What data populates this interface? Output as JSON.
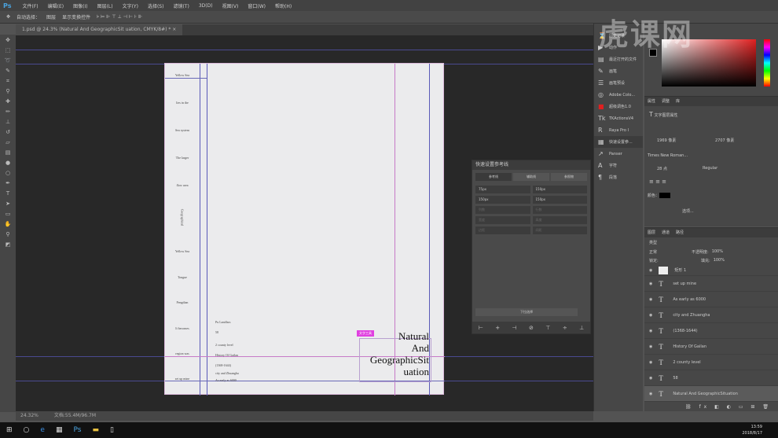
{
  "app": {
    "logo": "Ps",
    "menu": [
      "文件(F)",
      "编辑(E)",
      "图像(I)",
      "图层(L)",
      "文字(Y)",
      "选择(S)",
      "滤镜(T)",
      "3D(D)",
      "视图(V)",
      "窗口(W)",
      "帮助(H)"
    ]
  },
  "options": {
    "auto_select": "自动选择：",
    "layer_select": "图层",
    "show_transform": "显示变换控件"
  },
  "document": {
    "tab": "1.psd @ 24.3% (Natural And GeographicSit uation, CMYK/8#) * ×",
    "zoom": "24.32%",
    "doc_info": "文档:55.4M/96.7M"
  },
  "page": {
    "left_column": [
      "Yellow Sea",
      "lies in the",
      "Sea system",
      "The larger",
      "flow area",
      "Geographical",
      "Yellow Sea",
      "Tongue",
      "Pengdian",
      "It becomes",
      "region was",
      "set up mine"
    ],
    "body_lines": [
      "Pu Landfars",
      "58",
      "2 county level",
      "History Of Gailan",
      "(1368-1644)",
      "city and Zhuangha",
      "As early as 6000"
    ],
    "title": [
      "Natural",
      "And",
      "GeographicSit",
      "uation"
    ],
    "badge": "文字工具"
  },
  "quick_guide": {
    "title": "快速设置参考线",
    "tabs": [
      "参考线",
      "辅助线",
      "参照物"
    ],
    "fields": [
      "75px",
      "150px",
      "150px",
      "150px",
      "列数",
      "行数",
      "宽度",
      "高度",
      "边距",
      "间距"
    ],
    "footer": "下拉选择"
  },
  "dock": {
    "items": [
      "历史记录",
      "动作",
      "最近打开的文件",
      "画笔",
      "画笔预设",
      "Adobe Colo...",
      "超级调色1.0",
      "TKActionsV4",
      "Raya Pro I",
      "快速设置参...",
      "Panser",
      "字符",
      "段落"
    ]
  },
  "properties": {
    "tabs": [
      "属性",
      "调整",
      "库"
    ],
    "layer_type": "文字图层属性",
    "width": "1969 像素",
    "height": "2707 像素",
    "font": "Times New Roman...",
    "size": "28 点",
    "style": "Regular",
    "color_label": "颜色：",
    "more": "选项..."
  },
  "layers": {
    "tabs": [
      "图层",
      "通道",
      "路径"
    ],
    "filter": "类型",
    "blend": "正常",
    "opacity_label": "不透明度:",
    "opacity": "100%",
    "lock_label": "锁定:",
    "fill_label": "填充:",
    "fill": "100%",
    "items": [
      "矩形 1",
      "set up mine",
      "As early as 6000",
      "city and Zhuangha",
      "(1368-1644)",
      "History Of Gailan",
      "2 county level",
      "58",
      "Natural And GeographicSituation"
    ]
  },
  "taskbar": {
    "time": "13:59",
    "date": "2018/8/17"
  },
  "watermark": "虎课网",
  "colors": {
    "accent": "#e040e0",
    "guide": "#5a5ab8"
  }
}
